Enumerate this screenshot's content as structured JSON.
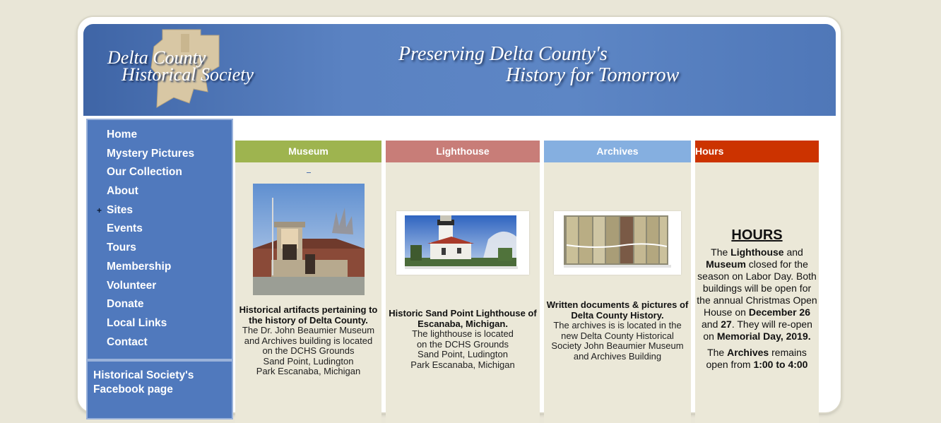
{
  "banner": {
    "logo_line1": "Delta County",
    "logo_line2": "Historical Society",
    "tagline_line1": "Preserving Delta County's",
    "tagline_line2": "History for Tomorrow"
  },
  "nav": {
    "items": [
      {
        "label": "Home"
      },
      {
        "label": "Mystery Pictures"
      },
      {
        "label": "Our Collection"
      },
      {
        "label": "About"
      },
      {
        "label": "Sites",
        "expand": "+"
      },
      {
        "label": "Events"
      },
      {
        "label": "Tours"
      },
      {
        "label": "Membership"
      },
      {
        "label": "Volunteer"
      },
      {
        "label": "Donate"
      },
      {
        "label": "Local Links"
      },
      {
        "label": "Contact"
      }
    ],
    "facebook_label": "Historical Society's Facebook page"
  },
  "columns": {
    "museum": {
      "header": "Museum",
      "caption_bold": "Historical artifacts pertaining to the history of Delta County.",
      "caption_l1": "The Dr. John Beaumier Museum",
      "caption_l2": "and Archives building  is located",
      "caption_l3": "on the DCHS Grounds",
      "caption_l4": "Sand Point, Ludington",
      "caption_l5": "Park Escanaba, Michigan"
    },
    "lighthouse": {
      "header": "Lighthouse",
      "caption_bold": "Historic Sand Point Lighthouse of Escanaba, Michigan.",
      "caption_l1": "The lighthouse is located",
      "caption_l2": "on the DCHS Grounds",
      "caption_l3": "Sand Point, Ludington",
      "caption_l4": "Park Escanaba, Michigan"
    },
    "archives": {
      "header": "Archives",
      "caption_bold": "Written documents & pictures of Delta County History.",
      "caption_l1": "The archives is is located  in the",
      "caption_l2": "new Delta County Historical",
      "caption_l3": "Society John Beaumier Museum",
      "caption_l4": "and Archives Building"
    },
    "hours": {
      "header": "Hours",
      "title": "HOURS",
      "p1_a": "The ",
      "p1_b": "Lighthouse",
      "p1_c": " and ",
      "p1_d": "Museum",
      "p1_e": " closed for the season on Labor Day. Both buildings will be open for the annual Christmas Open House on ",
      "p1_f": "December 26",
      "p1_g": " and ",
      "p1_h": "27",
      "p1_i": ". They will re-open on ",
      "p1_j": "Memorial Day, 2019.",
      "p2_a": "The ",
      "p2_b": "Archives",
      "p2_c": " remains open from ",
      "p2_d": "1:00 to 4:00"
    }
  },
  "colors": {
    "page_bg": "#e9e6d7",
    "banner": "#5a82c2",
    "nav": "#5079bd",
    "museum": "#9eb44f",
    "lighthouse": "#c87d78",
    "archives": "#85afe0",
    "hours": "#cc3300"
  }
}
